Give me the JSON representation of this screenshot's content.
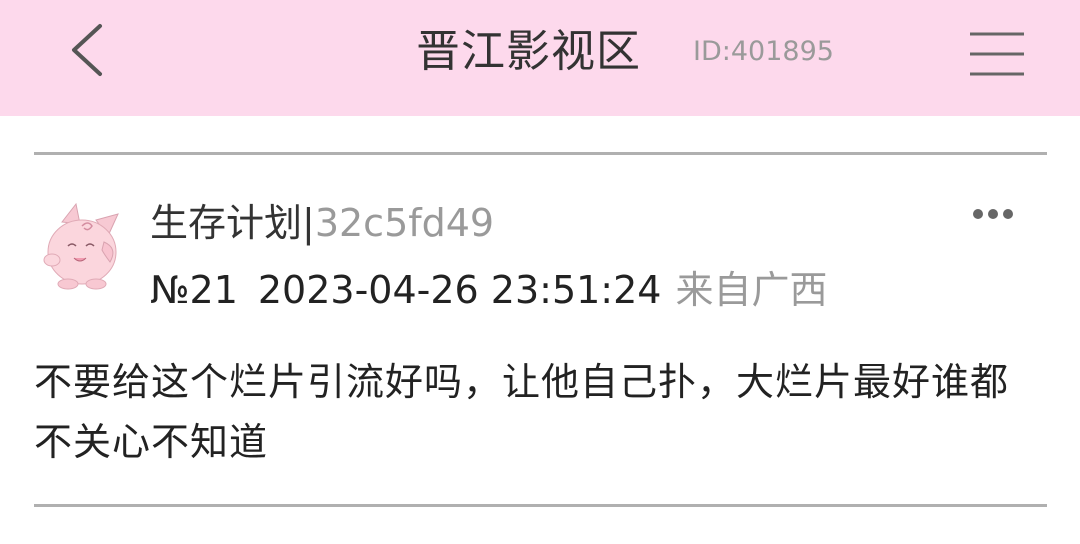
{
  "header": {
    "title": "晋江影视区",
    "id_label": "ID:401895",
    "back_icon": "chevron-left-icon",
    "menu_icon": "hamburger-menu-icon",
    "background_color": "#fdd9ec"
  },
  "post": {
    "author_name": "生存计划",
    "author_separator": "|",
    "author_hash": "32c5fd49",
    "floor": "№21",
    "timestamp": "2023-04-26 23:51:24",
    "location": "来自广西",
    "more_icon": "more-horizontal-icon",
    "content": "不要给这个烂片引流好吗，让他自己扑，大烂片最好谁都不关心不知道"
  }
}
